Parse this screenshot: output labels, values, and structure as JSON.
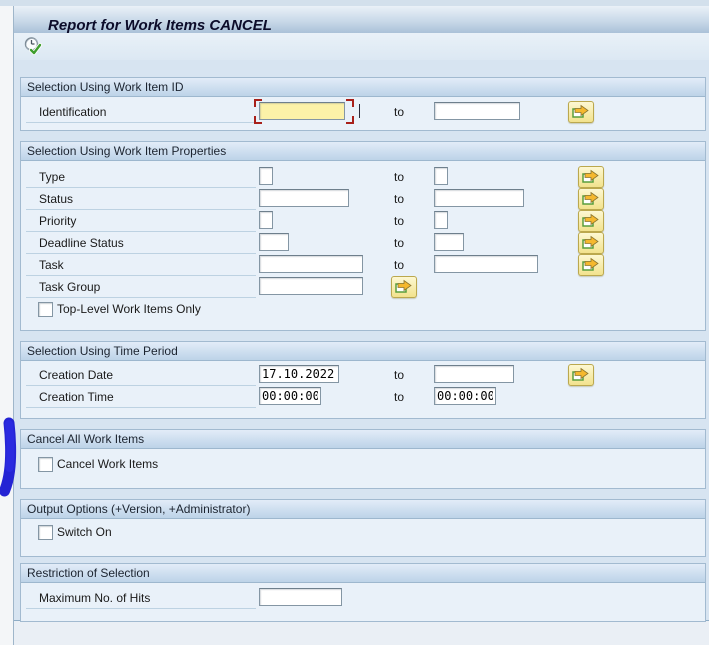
{
  "window": {
    "title": "Report for Work Items CANCEL"
  },
  "icons": {
    "execute": "clock-with-green-check",
    "multi_select": "yellow-arrow-over-page"
  },
  "ui": {
    "to_label": "to"
  },
  "sections": {
    "work_item_id": {
      "title": "Selection Using Work Item ID",
      "identification": {
        "label": "Identification",
        "from": "",
        "to": ""
      }
    },
    "properties": {
      "title": "Selection Using Work Item Properties",
      "type": {
        "label": "Type",
        "from": "",
        "to": ""
      },
      "status": {
        "label": "Status",
        "from": "",
        "to": ""
      },
      "priority": {
        "label": "Priority",
        "from": "",
        "to": ""
      },
      "deadline_status": {
        "label": "Deadline Status",
        "from": "",
        "to": ""
      },
      "task": {
        "label": "Task",
        "from": "",
        "to": ""
      },
      "task_group": {
        "label": "Task Group",
        "value": ""
      },
      "top_level_checkbox": {
        "label": "Top-Level Work Items Only",
        "checked": false
      }
    },
    "time_period": {
      "title": "Selection Using Time Period",
      "creation_date": {
        "label": "Creation Date",
        "from": "17.10.2022",
        "to": ""
      },
      "creation_time": {
        "label": "Creation Time",
        "from": "00:00:00",
        "to": "00:00:00"
      }
    },
    "cancel_all": {
      "title": "Cancel All Work Items",
      "checkbox": {
        "label": "Cancel Work Items",
        "checked": false
      }
    },
    "output_options": {
      "title": "Output Options (+Version, +Administrator)",
      "checkbox": {
        "label": "Switch On",
        "checked": false
      }
    },
    "restriction": {
      "title": "Restriction of Selection",
      "max_hits": {
        "label": "Maximum No. of Hits",
        "value": ""
      }
    }
  },
  "annotation": {
    "shape": "hand-drawn-vertical-stroke",
    "color": "#2424d4"
  },
  "colors": {
    "focused_field_bg": "#fcf2a8",
    "focus_frame_red": "#a8201a",
    "section_header_gradient_top": "#e2ecf8",
    "section_header_gradient_bottom": "#bdd3e8",
    "button_face_yellow": "#f2e28d",
    "panel_bg": "#d7e4f1"
  }
}
